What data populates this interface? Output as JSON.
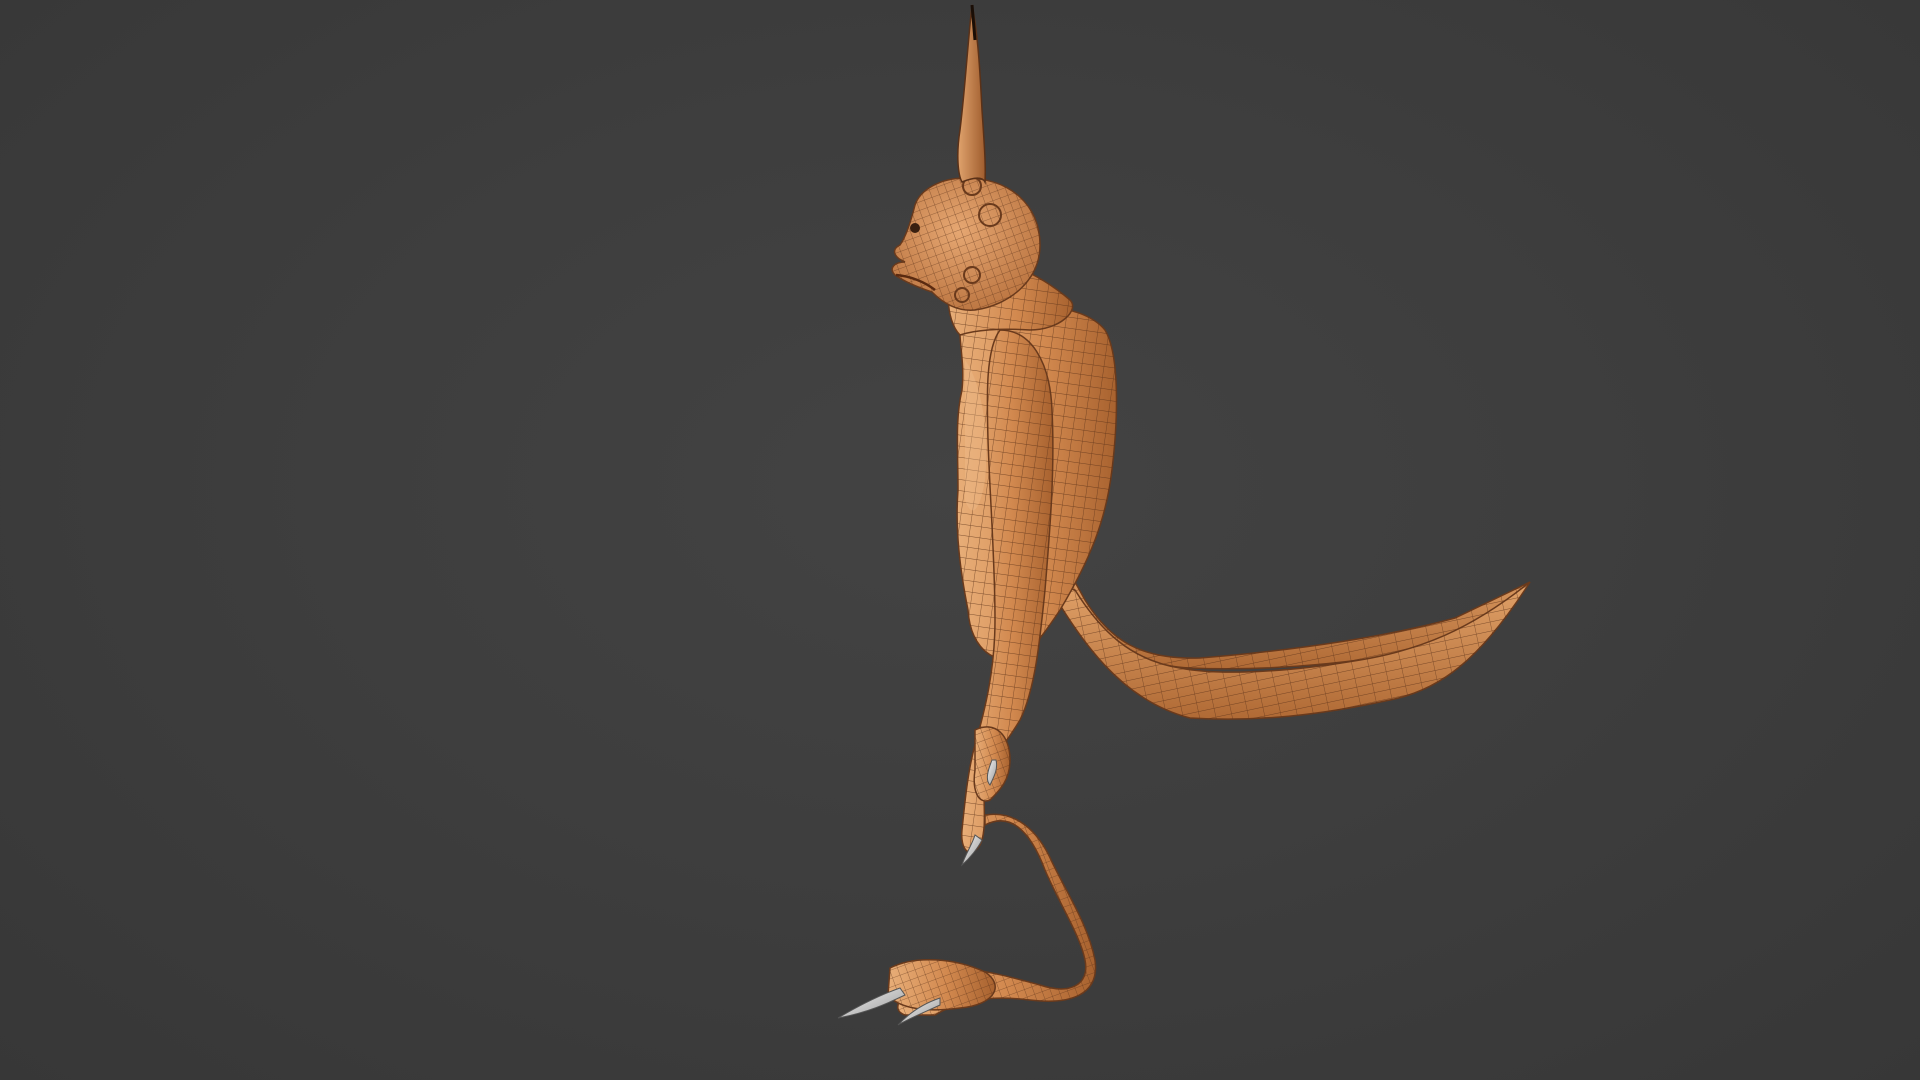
{
  "viewport": {
    "background_color": "#3d3d3d",
    "shading": "solid",
    "overlay": "wireframe-on-shaded"
  },
  "model": {
    "description_icon": "creature-mesh",
    "skin_color": "#d2894f",
    "skin_highlight": "#e9b27c",
    "skin_shadow": "#9a5a2c",
    "wire_color": "#5a3118",
    "claw_color": "#d8d8d8"
  }
}
